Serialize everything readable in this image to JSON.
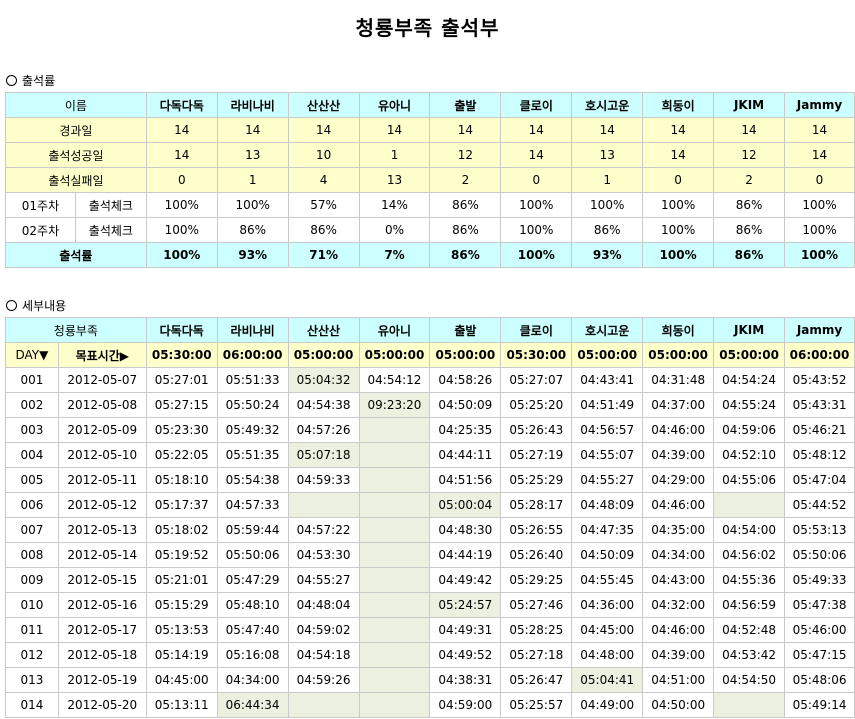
{
  "title": "청룡부족 출석부",
  "attendance": {
    "section_label": "출석률",
    "name_header": "이름",
    "members": [
      "다독다독",
      "라비나비",
      "산산산",
      "유아니",
      "출발",
      "클로이",
      "호시고운",
      "희동이",
      "JKIM",
      "Jammy"
    ],
    "rows": [
      {
        "label": "경과일",
        "values": [
          "14",
          "14",
          "14",
          "14",
          "14",
          "14",
          "14",
          "14",
          "14",
          "14"
        ]
      },
      {
        "label": "출석성공일",
        "values": [
          "14",
          "13",
          "10",
          "1",
          "12",
          "14",
          "13",
          "14",
          "12",
          "14"
        ]
      },
      {
        "label": "출석실패일",
        "values": [
          "0",
          "1",
          "4",
          "13",
          "2",
          "0",
          "1",
          "0",
          "2",
          "0"
        ]
      }
    ],
    "weeks": [
      {
        "week": "01주차",
        "label": "출석체크",
        "values": [
          "100%",
          "100%",
          "57%",
          "14%",
          "86%",
          "100%",
          "100%",
          "100%",
          "86%",
          "100%"
        ]
      },
      {
        "week": "02주차",
        "label": "출석체크",
        "values": [
          "100%",
          "86%",
          "86%",
          "0%",
          "86%",
          "100%",
          "86%",
          "100%",
          "86%",
          "100%"
        ]
      }
    ],
    "rate": {
      "label": "출석률",
      "values": [
        "100%",
        "93%",
        "71%",
        "7%",
        "86%",
        "100%",
        "93%",
        "100%",
        "86%",
        "100%"
      ]
    }
  },
  "detail": {
    "section_label": "세부내용",
    "tribe_header": "청룡부족",
    "day_label": "DAY▼",
    "target_label": "목표시간▶",
    "targets": [
      "05:30:00",
      "06:00:00",
      "05:00:00",
      "05:00:00",
      "05:00:00",
      "05:30:00",
      "05:00:00",
      "05:00:00",
      "05:00:00",
      "06:00:00"
    ],
    "rows": [
      {
        "day": "001",
        "date": "2012-05-07",
        "times": [
          "05:27:01",
          "05:51:33",
          "05:04:32",
          "04:54:12",
          "04:58:26",
          "05:27:07",
          "04:43:41",
          "04:31:48",
          "04:54:24",
          "05:43:52"
        ]
      },
      {
        "day": "002",
        "date": "2012-05-08",
        "times": [
          "05:27:15",
          "05:50:24",
          "04:54:38",
          "09:23:20",
          "04:50:09",
          "05:25:20",
          "04:51:49",
          "04:37:00",
          "04:55:24",
          "05:43:31"
        ]
      },
      {
        "day": "003",
        "date": "2012-05-09",
        "times": [
          "05:23:30",
          "05:49:32",
          "04:57:26",
          "",
          "04:25:35",
          "05:26:43",
          "04:56:57",
          "04:46:00",
          "04:59:06",
          "05:46:21"
        ]
      },
      {
        "day": "004",
        "date": "2012-05-10",
        "times": [
          "05:22:05",
          "05:51:35",
          "05:07:18",
          "",
          "04:44:11",
          "05:27:19",
          "04:55:07",
          "04:39:00",
          "04:52:10",
          "05:48:12"
        ]
      },
      {
        "day": "005",
        "date": "2012-05-11",
        "times": [
          "05:18:10",
          "05:54:38",
          "04:59:33",
          "",
          "04:51:56",
          "05:25:29",
          "04:55:27",
          "04:29:00",
          "04:55:06",
          "05:47:04"
        ]
      },
      {
        "day": "006",
        "date": "2012-05-12",
        "times": [
          "05:17:37",
          "04:57:33",
          "",
          "",
          "05:00:04",
          "05:28:17",
          "04:48:09",
          "04:46:00",
          "",
          "05:44:52"
        ]
      },
      {
        "day": "007",
        "date": "2012-05-13",
        "times": [
          "05:18:02",
          "05:59:44",
          "04:57:22",
          "",
          "04:48:30",
          "05:26:55",
          "04:47:35",
          "04:35:00",
          "04:54:00",
          "05:53:13"
        ]
      },
      {
        "day": "008",
        "date": "2012-05-14",
        "times": [
          "05:19:52",
          "05:50:06",
          "04:53:30",
          "",
          "04:44:19",
          "05:26:40",
          "04:50:09",
          "04:34:00",
          "04:56:02",
          "05:50:06"
        ]
      },
      {
        "day": "009",
        "date": "2012-05-15",
        "times": [
          "05:21:01",
          "05:47:29",
          "04:55:27",
          "",
          "04:49:42",
          "05:29:25",
          "04:55:45",
          "04:43:00",
          "04:55:36",
          "05:49:33"
        ]
      },
      {
        "day": "010",
        "date": "2012-05-16",
        "times": [
          "05:15:29",
          "05:48:10",
          "04:48:04",
          "",
          "05:24:57",
          "05:27:46",
          "04:36:00",
          "04:32:00",
          "04:56:59",
          "05:47:38"
        ]
      },
      {
        "day": "011",
        "date": "2012-05-17",
        "times": [
          "05:13:53",
          "05:47:40",
          "04:59:02",
          "",
          "04:49:31",
          "05:28:25",
          "04:45:00",
          "04:46:00",
          "04:52:48",
          "05:46:00"
        ]
      },
      {
        "day": "012",
        "date": "2012-05-18",
        "times": [
          "05:14:19",
          "05:16:08",
          "04:54:18",
          "",
          "04:49:52",
          "05:27:18",
          "04:48:00",
          "04:39:00",
          "04:53:42",
          "05:47:15"
        ]
      },
      {
        "day": "013",
        "date": "2012-05-19",
        "times": [
          "04:45:00",
          "04:34:00",
          "04:59:26",
          "",
          "04:38:31",
          "05:26:47",
          "05:04:41",
          "04:51:00",
          "04:54:50",
          "05:48:06"
        ]
      },
      {
        "day": "014",
        "date": "2012-05-20",
        "times": [
          "05:13:11",
          "06:44:34",
          "",
          "",
          "04:59:00",
          "05:25:57",
          "04:49:00",
          "04:50:00",
          "",
          "05:49:14"
        ]
      }
    ]
  }
}
